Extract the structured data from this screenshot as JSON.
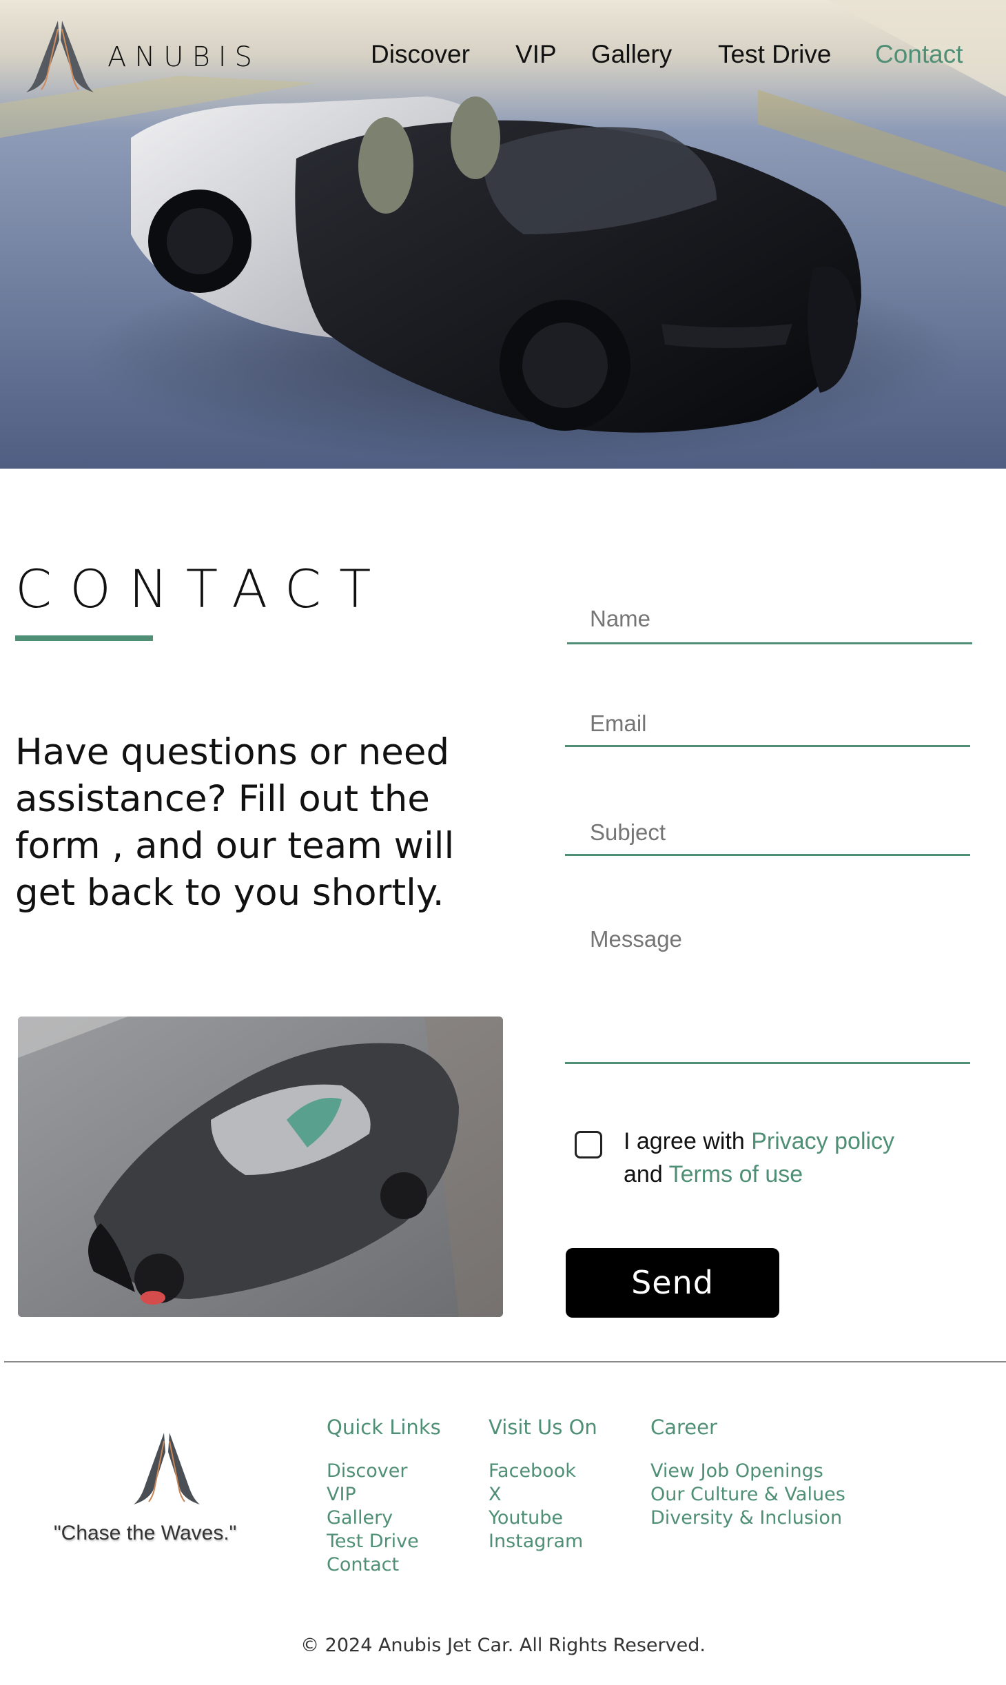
{
  "header": {
    "brand": "ANUBIS",
    "nav": [
      {
        "label": "Discover"
      },
      {
        "label": "VIP"
      },
      {
        "label": "Gallery"
      },
      {
        "label": "Test Drive"
      },
      {
        "label": "Contact",
        "active": true
      }
    ]
  },
  "contact": {
    "title": "CONTACT",
    "lead": "Have questions or need assistance? Fill out the form , and our team will get back to you shortly.",
    "form": {
      "name_placeholder": "Name",
      "email_placeholder": "Email",
      "subject_placeholder": "Subject",
      "message_placeholder": "Message",
      "agree_prefix": "I agree with",
      "privacy_link": "Privacy policy",
      "agree_and": "and",
      "terms_link": "Terms of use",
      "agree_checked": false,
      "send_label": "Send"
    }
  },
  "footer": {
    "tagline": "\"Chase the Waves.\"",
    "columns": [
      {
        "heading": "Quick Links",
        "items": [
          "Discover",
          "VIP",
          "Gallery",
          "Test Drive",
          "Contact"
        ]
      },
      {
        "heading": "Visit Us On",
        "items": [
          "Facebook",
          "X",
          "Youtube",
          "Instagram"
        ]
      },
      {
        "heading": "Career",
        "items": [
          "View Job Openings",
          "Our Culture & Values",
          "Diversity & Inclusion"
        ]
      }
    ],
    "copyright": "© 2024 Anubis Jet Car. All Rights Reserved."
  },
  "colors": {
    "accent": "#4f8f76",
    "button_bg": "#000000",
    "text": "#111111"
  },
  "icons": [
    "anubis-logo-icon",
    "checkbox-icon"
  ]
}
